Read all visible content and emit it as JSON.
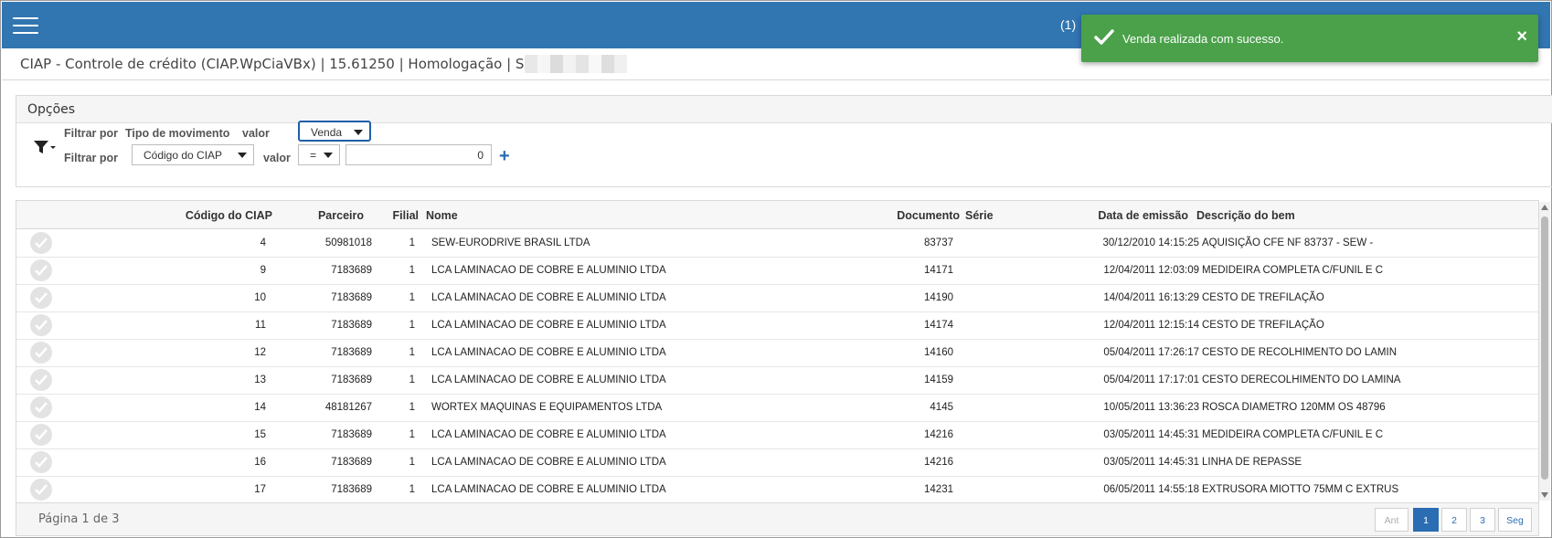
{
  "topbar": {
    "notification_count": "(1)"
  },
  "toast": {
    "message": "Venda realizada com sucesso.",
    "close": "×"
  },
  "title": "CIAP - Controle de crédito (CIAP.WpCiaVBx) | 15.61250 | Homologação | SIS_",
  "options": {
    "heading": "Opções",
    "filter1": {
      "label": "Filtrar por",
      "field": "Tipo de movimento",
      "valor_label": "valor",
      "value": "Venda"
    },
    "filter2": {
      "label": "Filtrar por",
      "field": "Código do CIAP",
      "valor_label": "valor",
      "operator": "=",
      "value": "0"
    },
    "add": "+"
  },
  "table": {
    "columns": [
      "Código do CIAP",
      "Parceiro",
      "Filial",
      "Nome",
      "Documento",
      "Série",
      "Data de emissão",
      "Descrição do bem"
    ],
    "rows": [
      [
        "4",
        "50981018",
        "1",
        "SEW-EURODRIVE BRASIL LTDA",
        "83737",
        "",
        "30/12/2010 14:15:25",
        "AQUISIÇÃO CFE NF 83737 - SEW -"
      ],
      [
        "9",
        "7183689",
        "1",
        "LCA LAMINACAO DE COBRE E ALUMINIO LTDA",
        "14171",
        "",
        "12/04/2011 12:03:09",
        "MEDIDEIRA COMPLETA C/FUNIL E C"
      ],
      [
        "10",
        "7183689",
        "1",
        "LCA LAMINACAO DE COBRE E ALUMINIO LTDA",
        "14190",
        "",
        "14/04/2011 16:13:29",
        "CESTO DE TREFILAÇÃO"
      ],
      [
        "11",
        "7183689",
        "1",
        "LCA LAMINACAO DE COBRE E ALUMINIO LTDA",
        "14174",
        "",
        "12/04/2011 12:15:14",
        "CESTO DE TREFILAÇÃO"
      ],
      [
        "12",
        "7183689",
        "1",
        "LCA LAMINACAO DE COBRE E ALUMINIO LTDA",
        "14160",
        "",
        "05/04/2011 17:26:17",
        "CESTO DE RECOLHIMENTO DO LAMIN"
      ],
      [
        "13",
        "7183689",
        "1",
        "LCA LAMINACAO DE COBRE E ALUMINIO LTDA",
        "14159",
        "",
        "05/04/2011 17:17:01",
        "CESTO DERECOLHIMENTO DO LAMINA"
      ],
      [
        "14",
        "48181267",
        "1",
        "WORTEX MAQUINAS E EQUIPAMENTOS LTDA",
        "4145",
        "",
        "10/05/2011 13:36:23",
        "ROSCA DIAMETRO 120MM OS 48796"
      ],
      [
        "15",
        "7183689",
        "1",
        "LCA LAMINACAO DE COBRE E ALUMINIO LTDA",
        "14216",
        "",
        "03/05/2011 14:45:31",
        "MEDIDEIRA COMPLETA C/FUNIL E C"
      ],
      [
        "16",
        "7183689",
        "1",
        "LCA LAMINACAO DE COBRE E ALUMINIO LTDA",
        "14216",
        "",
        "03/05/2011 14:45:31",
        "LINHA DE REPASSE"
      ],
      [
        "17",
        "7183689",
        "1",
        "LCA LAMINACAO DE COBRE E ALUMINIO LTDA",
        "14231",
        "",
        "06/05/2011 14:55:18",
        "EXTRUSORA MIOTTO 75MM C EXTRUS"
      ]
    ]
  },
  "footer": {
    "page_info": "Página 1 de 3",
    "pager": {
      "prev": "Ant",
      "pages": [
        "1",
        "2",
        "3"
      ],
      "next": "Seg",
      "current": "1"
    }
  },
  "colors": {
    "topbar": "#3175b1",
    "toast": "#4aa14a",
    "accent": "#2a6db3"
  },
  "icons": [
    "hamburger-menu-icon",
    "check-icon",
    "close-icon",
    "filter-funnel-icon",
    "plus-icon",
    "row-check-icon"
  ]
}
